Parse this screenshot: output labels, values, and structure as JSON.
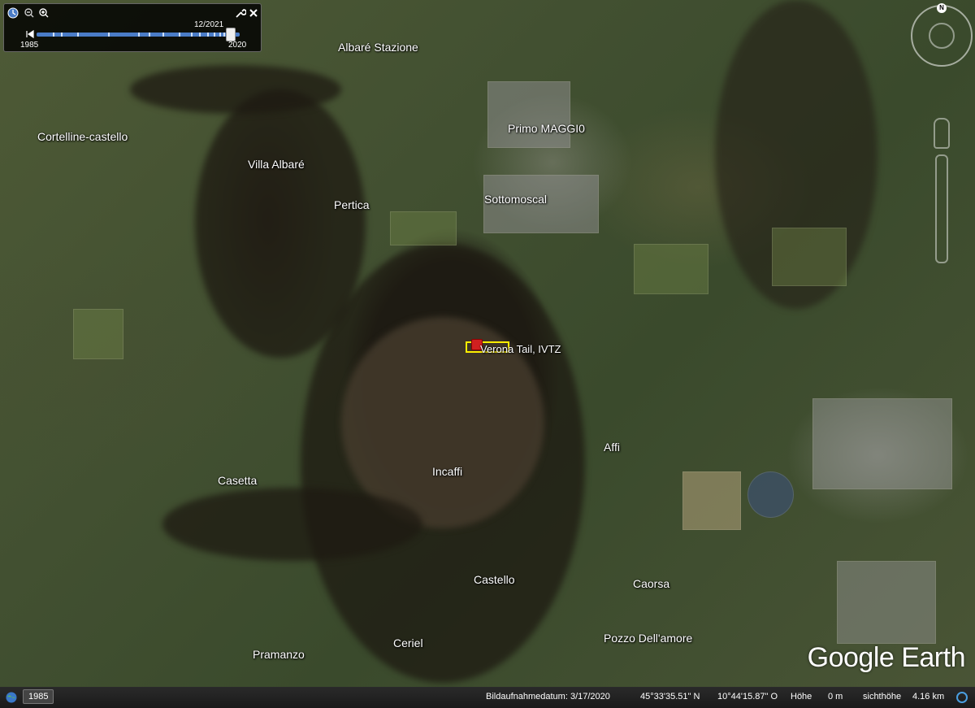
{
  "app": {
    "title": "Google Earth"
  },
  "time_slider": {
    "start_year": "1985",
    "end_year": "2020",
    "current_date": "12/2021",
    "position_fraction": 0.95,
    "icons": [
      "clock-icon",
      "zoom-out-icon",
      "zoom-in-icon",
      "wrench-icon",
      "close-icon",
      "play-back-icon"
    ]
  },
  "map": {
    "places": [
      "Albaré Stazione",
      "Cortelline-castello",
      "Villa Albaré",
      "Pertica",
      "Primo MAGGI0",
      "Sottomoscal",
      "Affi",
      "Incaffi",
      "Casetta",
      "Castello",
      "Caorsa",
      "Pozzo Dell'amore",
      "Pramanzo",
      "Ceriel"
    ],
    "marker_label": "Verona Tail, IVTZ"
  },
  "branding": {
    "logo": "Google Earth"
  },
  "status_bar": {
    "imagery_year": "1985",
    "image_date": "Bildaufnahmedatum: 3/17/2020",
    "latitude": "45°33'35.51\" N",
    "longitude": "10°44'15.87\" O",
    "elevation_label": "Höhe",
    "elevation_value": "0 m",
    "eye_alt_label": "sichthöhe",
    "eye_alt_value": "4.16 km"
  },
  "colors": {
    "marker_box": "#ffee00",
    "marker_pin": "#d02020",
    "slider": "#4a7cc7"
  }
}
